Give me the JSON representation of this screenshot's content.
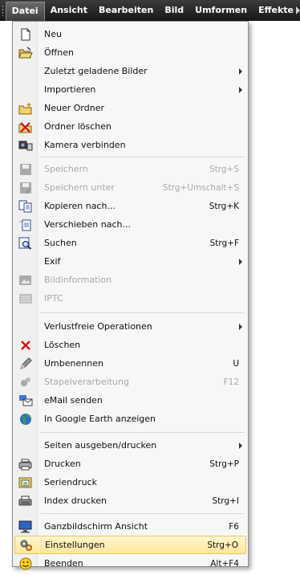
{
  "menubar": {
    "items": [
      "Datei",
      "Ansicht",
      "Bearbeiten",
      "Bild",
      "Umformen",
      "Effekte"
    ],
    "active": "Datei"
  },
  "menu": {
    "items": [
      {
        "label": "Neu",
        "shortcut": "",
        "icon": "new-file-icon"
      },
      {
        "label": "Öffnen",
        "shortcut": "",
        "icon": "open-folder-icon"
      },
      {
        "label": "Zuletzt geladene Bilder",
        "shortcut": "",
        "submenu": true
      },
      {
        "label": "Importieren",
        "shortcut": "",
        "submenu": true
      },
      {
        "label": "Neuer Ordner",
        "shortcut": "",
        "icon": "new-folder-icon"
      },
      {
        "label": "Ordner löschen",
        "shortcut": "",
        "icon": "delete-folder-icon"
      },
      {
        "label": "Kamera verbinden",
        "shortcut": "",
        "icon": "camera-icon"
      },
      {
        "label": "Speichern",
        "shortcut": "Strg+S",
        "icon": "save-icon",
        "disabled": true
      },
      {
        "label": "Speichern unter",
        "shortcut": "Strg+Umschalt+S",
        "icon": "save-as-icon",
        "disabled": true
      },
      {
        "label": "Kopieren nach...",
        "shortcut": "Strg+K",
        "icon": "copy-icon"
      },
      {
        "label": "Verschieben nach...",
        "shortcut": "",
        "icon": "move-icon"
      },
      {
        "label": "Suchen",
        "shortcut": "Strg+F",
        "icon": "search-icon"
      },
      {
        "label": "Exif",
        "shortcut": "",
        "submenu": true
      },
      {
        "label": "Bildinformation",
        "shortcut": "",
        "icon": "image-info-icon",
        "disabled": true
      },
      {
        "label": "IPTC",
        "shortcut": "",
        "icon": "iptc-icon",
        "disabled": true
      },
      {
        "label": "Verlustfreie Operationen",
        "shortcut": "",
        "submenu": true
      },
      {
        "label": "Löschen",
        "shortcut": "",
        "icon": "delete-icon"
      },
      {
        "label": "Umbenennen",
        "shortcut": "U",
        "icon": "rename-icon"
      },
      {
        "label": "Stapelverarbeitung",
        "shortcut": "F12",
        "icon": "batch-icon",
        "disabled": true
      },
      {
        "label": "eMail senden",
        "shortcut": "",
        "icon": "email-icon"
      },
      {
        "label": "In Google Earth anzeigen",
        "shortcut": "",
        "icon": "globe-icon"
      },
      {
        "label": "Seiten ausgeben/drucken",
        "shortcut": "",
        "submenu": true
      },
      {
        "label": "Drucken",
        "shortcut": "Strg+P",
        "icon": "printer-icon"
      },
      {
        "label": "Seriendruck",
        "shortcut": "",
        "icon": "serial-print-icon"
      },
      {
        "label": "Index drucken",
        "shortcut": "Strg+I",
        "icon": "index-print-icon"
      },
      {
        "label": "Ganzbildschirm Ansicht",
        "shortcut": "F6",
        "icon": "monitor-icon"
      },
      {
        "label": "Einstellungen",
        "shortcut": "Strg+O",
        "icon": "settings-icon",
        "highlight": true
      },
      {
        "label": "Beenden",
        "shortcut": "Alt+F4",
        "icon": "smiley-exit-icon"
      }
    ]
  },
  "colors": {
    "menubar_bg": "#262626",
    "highlight": "#fde79a",
    "disabled_text": "#a8a8a8"
  }
}
